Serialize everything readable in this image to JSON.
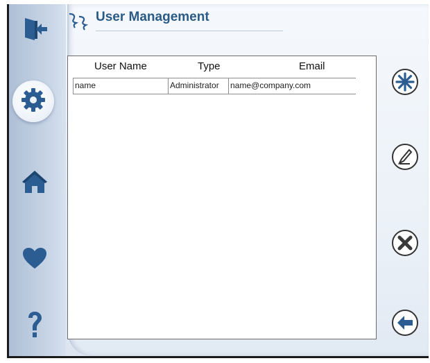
{
  "window": {
    "title": "User Management"
  },
  "sidebar": {
    "items": [
      {
        "name": "logout",
        "icon": "logout-door-icon"
      },
      {
        "name": "settings",
        "icon": "gear-icon",
        "active": true
      },
      {
        "name": "home",
        "icon": "home-icon"
      },
      {
        "name": "favorites",
        "icon": "heart-icon"
      },
      {
        "name": "help",
        "icon": "question-mark-icon"
      }
    ]
  },
  "table": {
    "headers": [
      "User Name",
      "Type",
      "Email"
    ],
    "rows": [
      [
        "name",
        "Administrator",
        "name@company.com"
      ]
    ]
  },
  "actions": [
    {
      "name": "add",
      "icon": "asterisk-add-icon"
    },
    {
      "name": "edit",
      "icon": "pen-edit-icon"
    },
    {
      "name": "delete",
      "icon": "x-delete-icon"
    },
    {
      "name": "back",
      "icon": "arrow-left-icon"
    }
  ],
  "colors": {
    "title": "#2a5b86",
    "icon_blue": "#2b5d92",
    "rail": "#c8d5e6"
  }
}
